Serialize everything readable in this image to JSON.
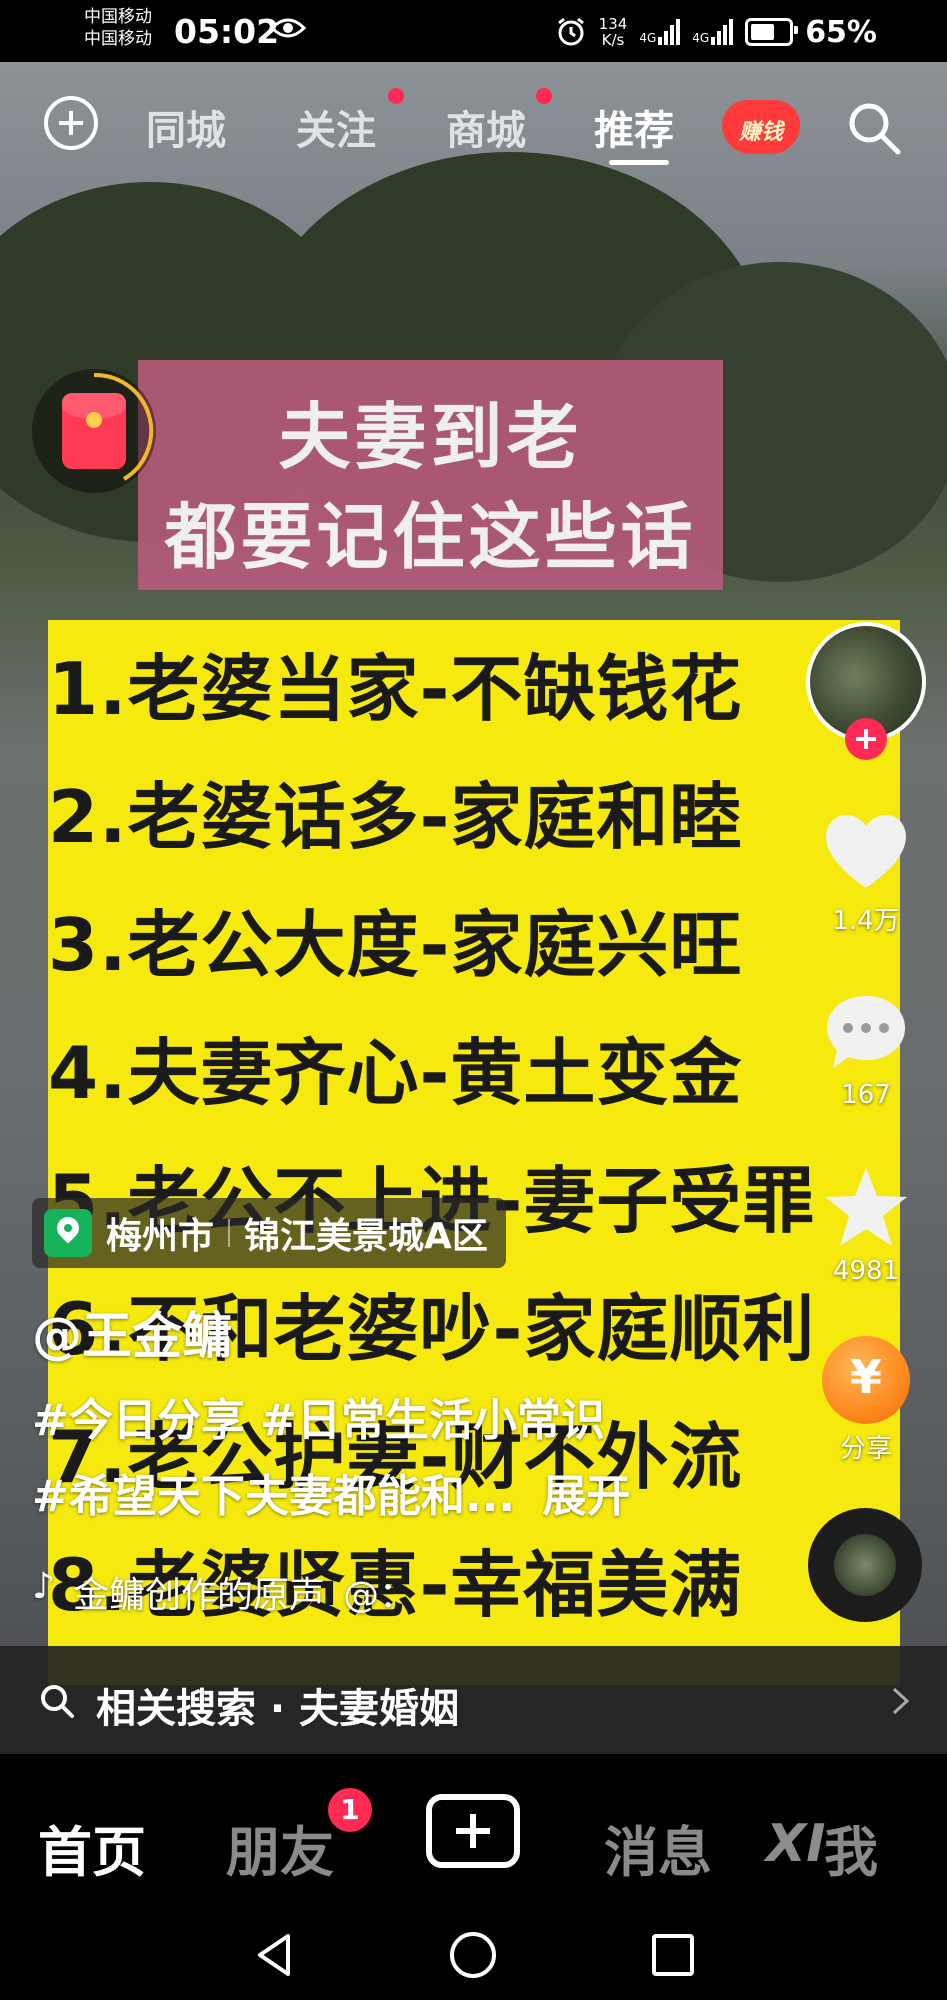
{
  "status_bar": {
    "carrier_1": "中国移动",
    "carrier_2": "中国移动",
    "time": "05:02",
    "net_speed_value": "134",
    "net_speed_unit": "K/s",
    "signal_1": "4G",
    "signal_2": "4G",
    "battery": "65%",
    "battery_level": 0.65
  },
  "top_nav": {
    "tabs": [
      "同城",
      "关注",
      "商城",
      "推荐"
    ],
    "active_tab": "推荐",
    "earn_label": "赚钱"
  },
  "video": {
    "title_line_1": "夫妻到老",
    "title_line_2": "都要记住这些话",
    "rules": [
      "1.老婆当家-不缺钱花",
      "2.老婆话多-家庭和睦",
      "3.老公大度-家庭兴旺",
      "4.夫妻齐心-黄土变金",
      "5.老公不上进-妻子受罪",
      "6.不和老婆吵-家庭顺利",
      "7.老公护妻-财不外流",
      "8.老婆贤惠-幸福美满"
    ]
  },
  "actions": {
    "likes": "1.4万",
    "comments": "167",
    "favorites": "4981",
    "share_label": "分享",
    "coin_symbol": "¥"
  },
  "caption": {
    "location_city": "梅州市",
    "location_place": "锦江美景城A区",
    "author": "@王金鳙",
    "tags_line_1": "#今日分享 #日常生活小常识",
    "tags_line_2": "#希望天下夫妻都能和...",
    "expand_label": "展开",
    "music_note": "♪",
    "music": "金鳙创作的原声",
    "music_at": "@："
  },
  "related_search": {
    "label": "相关搜索 · 夫妻婚姻"
  },
  "bottom_nav": {
    "items": [
      "首页",
      "朋友",
      "消息",
      "我"
    ],
    "friends_badge": "1",
    "watermark": "XI"
  }
}
